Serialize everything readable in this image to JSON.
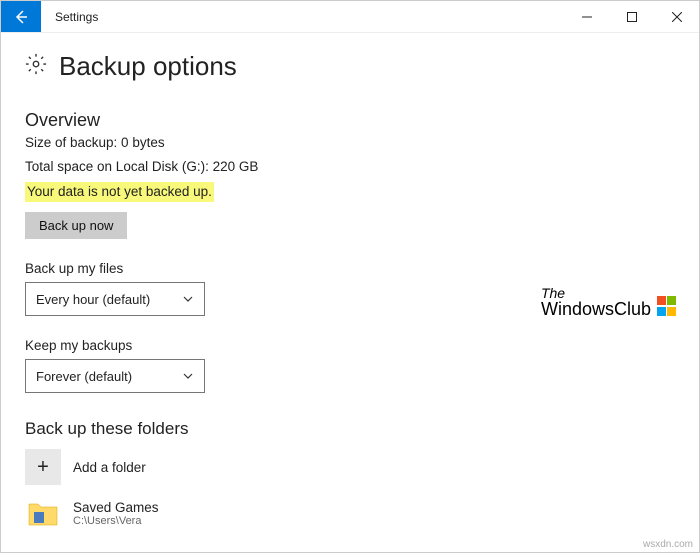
{
  "window": {
    "title": "Settings"
  },
  "page": {
    "title": "Backup options"
  },
  "overview": {
    "heading": "Overview",
    "backup_size": "Size of backup: 0 bytes",
    "total_space": "Total space on Local Disk (G:): 220 GB",
    "status": "Your data is not yet backed up.",
    "backup_now_label": "Back up now"
  },
  "frequency": {
    "label": "Back up my files",
    "value": "Every hour (default)"
  },
  "retention": {
    "label": "Keep my backups",
    "value": "Forever (default)"
  },
  "folders": {
    "heading": "Back up these folders",
    "add_label": "Add a folder",
    "items": [
      {
        "name": "Saved Games",
        "path": "C:\\Users\\Vera"
      }
    ]
  },
  "watermark": {
    "line1": "The",
    "line2": "WindowsClub"
  },
  "attribution": "wsxdn.com"
}
